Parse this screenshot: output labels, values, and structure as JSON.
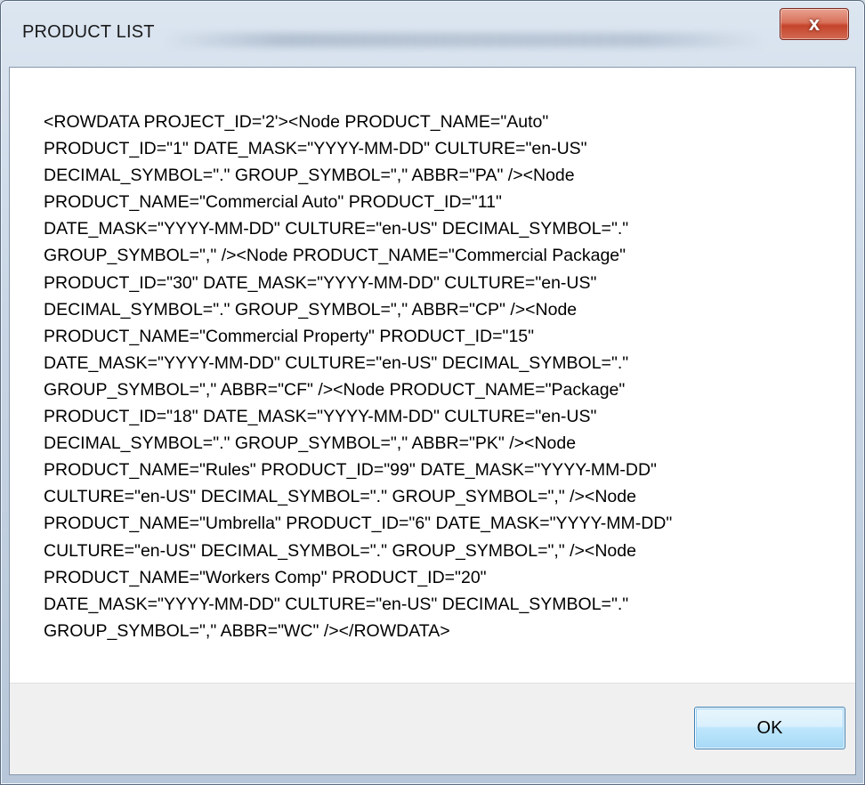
{
  "window": {
    "title": "PRODUCT LIST",
    "close_label": "x"
  },
  "message": {
    "lines": [
      "<ROWDATA PROJECT_ID='2'><Node PRODUCT_NAME=\"Auto\"",
      "PRODUCT_ID=\"1\" DATE_MASK=\"YYYY-MM-DD\" CULTURE=\"en-US\"",
      "DECIMAL_SYMBOL=\".\" GROUP_SYMBOL=\",\" ABBR=\"PA\" /><Node",
      "PRODUCT_NAME=\"Commercial Auto\" PRODUCT_ID=\"11\"",
      "DATE_MASK=\"YYYY-MM-DD\" CULTURE=\"en-US\" DECIMAL_SYMBOL=\".\"",
      "GROUP_SYMBOL=\",\" /><Node PRODUCT_NAME=\"Commercial Package\"",
      "PRODUCT_ID=\"30\" DATE_MASK=\"YYYY-MM-DD\" CULTURE=\"en-US\"",
      "DECIMAL_SYMBOL=\".\" GROUP_SYMBOL=\",\" ABBR=\"CP\" /><Node",
      "PRODUCT_NAME=\"Commercial Property\" PRODUCT_ID=\"15\"",
      "DATE_MASK=\"YYYY-MM-DD\" CULTURE=\"en-US\" DECIMAL_SYMBOL=\".\"",
      "GROUP_SYMBOL=\",\" ABBR=\"CF\" /><Node PRODUCT_NAME=\"Package\"",
      "PRODUCT_ID=\"18\" DATE_MASK=\"YYYY-MM-DD\" CULTURE=\"en-US\"",
      "DECIMAL_SYMBOL=\".\" GROUP_SYMBOL=\",\" ABBR=\"PK\" /><Node",
      "PRODUCT_NAME=\"Rules\" PRODUCT_ID=\"99\" DATE_MASK=\"YYYY-MM-DD\"",
      "CULTURE=\"en-US\" DECIMAL_SYMBOL=\".\" GROUP_SYMBOL=\",\" /><Node",
      "PRODUCT_NAME=\"Umbrella\" PRODUCT_ID=\"6\" DATE_MASK=\"YYYY-MM-DD\"",
      "CULTURE=\"en-US\" DECIMAL_SYMBOL=\".\" GROUP_SYMBOL=\",\" /><Node",
      "PRODUCT_NAME=\"Workers Comp\" PRODUCT_ID=\"20\"",
      "DATE_MASK=\"YYYY-MM-DD\" CULTURE=\"en-US\" DECIMAL_SYMBOL=\".\"",
      "GROUP_SYMBOL=\",\" ABBR=\"WC\" /></ROWDATA>"
    ]
  },
  "buttons": {
    "ok_label": "OK"
  },
  "icons": {
    "close": "close-icon"
  },
  "colors": {
    "close_button": "#c4442b",
    "ok_button_border": "#3c7fb1"
  }
}
